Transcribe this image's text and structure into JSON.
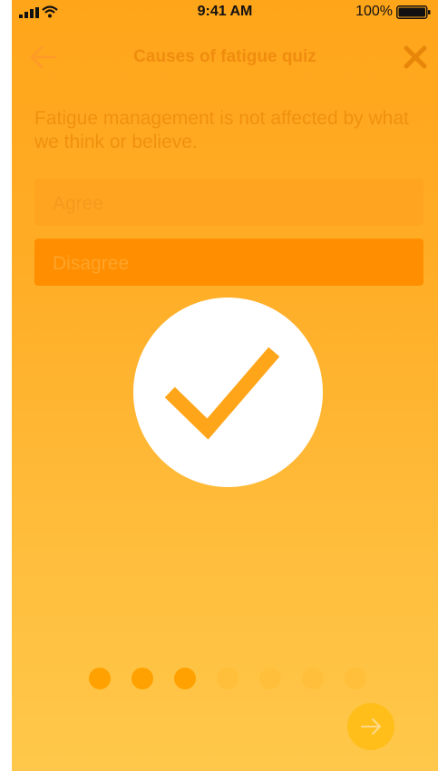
{
  "status_bar": {
    "time": "9:41 AM",
    "battery_percent": "100%",
    "icons": [
      "signal-icon",
      "wifi-icon",
      "battery-icon"
    ]
  },
  "nav": {
    "title": "Causes of fatigue quiz",
    "back_icon": "arrow-left-icon",
    "close_icon": "close-icon"
  },
  "question": {
    "text": "Fatigue management is not affected by what we think or believe."
  },
  "answers": [
    {
      "label": "Agree",
      "selected": false
    },
    {
      "label": "Disagree",
      "selected": true
    }
  ],
  "result": {
    "icon": "checkmark-icon",
    "correct": true
  },
  "progress": {
    "current": 3,
    "total": 7
  },
  "next": {
    "icon": "arrow-right-icon"
  },
  "colors": {
    "accent": "#ff8e00",
    "title": "#f08c0e",
    "background_top": "#ffa51a",
    "background_bottom": "#ffc84a",
    "check_circle": "#ffffff",
    "check_mark": "#ffa51a"
  }
}
